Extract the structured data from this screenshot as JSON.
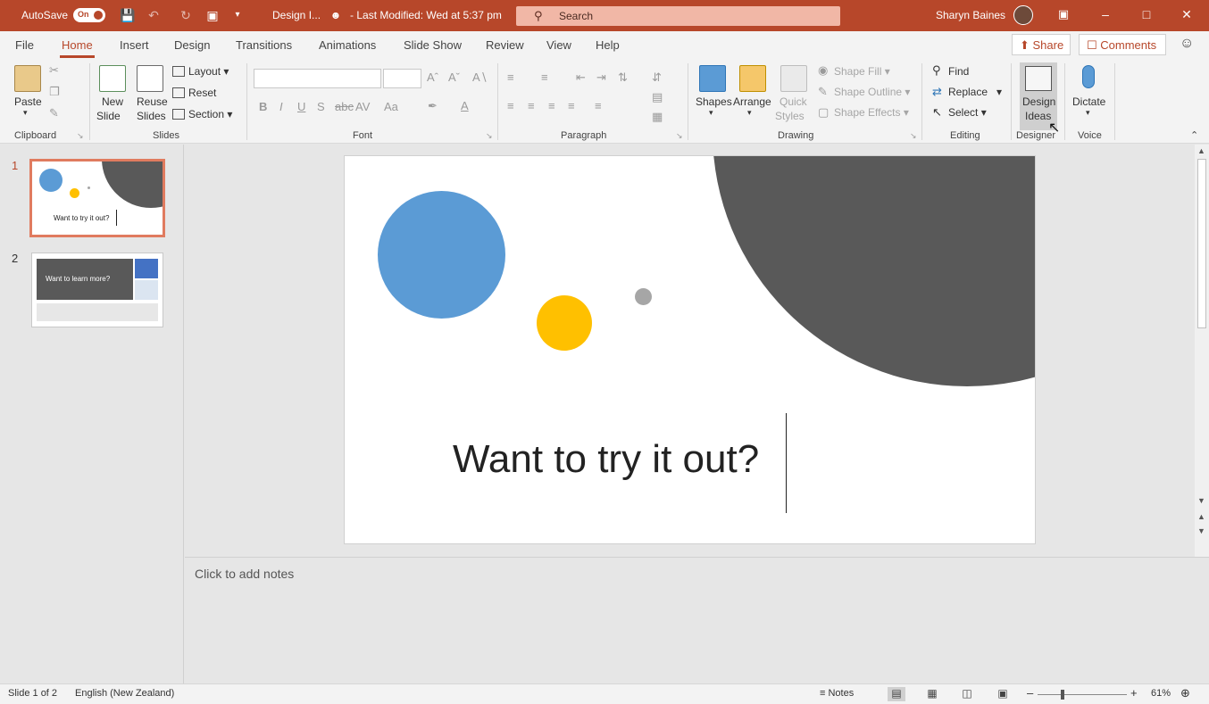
{
  "titlebar": {
    "autosave_label": "AutoSave",
    "autosave_state": "On",
    "doc_name": "Design I...",
    "last_modified": "Last Modified: Wed at 5:37 pm",
    "search_placeholder": "Search",
    "user_name": "Sharyn Baines",
    "accent_color": "#b7472a"
  },
  "tabs": [
    {
      "label": "File"
    },
    {
      "label": "Home"
    },
    {
      "label": "Insert"
    },
    {
      "label": "Design"
    },
    {
      "label": "Transitions"
    },
    {
      "label": "Animations"
    },
    {
      "label": "Slide Show"
    },
    {
      "label": "Review"
    },
    {
      "label": "View"
    },
    {
      "label": "Help"
    }
  ],
  "active_tab": "Home",
  "share_label": "Share",
  "comments_label": "Comments",
  "ribbon": {
    "clipboard": {
      "paste": "Paste",
      "label": "Clipboard"
    },
    "slides": {
      "new_slide_1": "New",
      "new_slide_2": "Slide",
      "reuse_1": "Reuse",
      "reuse_2": "Slides",
      "layout": "Layout",
      "reset": "Reset",
      "section": "Section",
      "label": "Slides"
    },
    "font": {
      "label": "Font"
    },
    "paragraph": {
      "label": "Paragraph"
    },
    "drawing": {
      "shapes": "Shapes",
      "arrange": "Arrange",
      "quick_1": "Quick",
      "quick_2": "Styles",
      "shape_fill": "Shape Fill",
      "shape_outline": "Shape Outline",
      "shape_effects": "Shape Effects",
      "label": "Drawing"
    },
    "editing": {
      "find": "Find",
      "replace": "Replace",
      "select": "Select",
      "label": "Editing"
    },
    "designer": {
      "ideas_1": "Design",
      "ideas_2": "Ideas",
      "label": "Designer"
    },
    "voice": {
      "dictate": "Dictate",
      "label": "Voice"
    }
  },
  "thumbnails": [
    {
      "number": "1",
      "caption": "Want to try it out?"
    },
    {
      "number": "2",
      "caption": "Want to learn more?"
    }
  ],
  "slide": {
    "title": "Want to try it out?",
    "colors": {
      "blue": "#5b9bd5",
      "yellow": "#ffc000",
      "gray_small": "#a6a6a6",
      "dark": "#595959"
    }
  },
  "notes_placeholder": "Click to add notes",
  "status": {
    "slide_counter": "Slide 1 of 2",
    "language": "English (New Zealand)",
    "notes": "Notes",
    "zoom": "61%",
    "zoom_level": 0.61
  }
}
